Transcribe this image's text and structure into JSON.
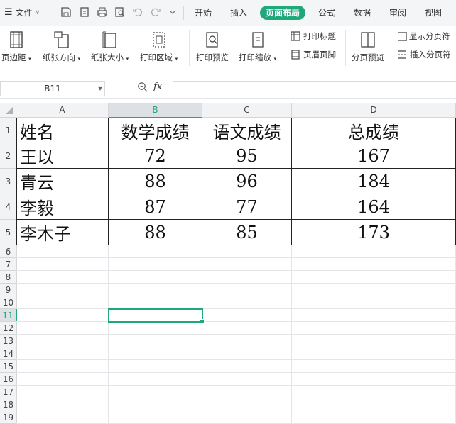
{
  "file_menu": {
    "label": "文件"
  },
  "tabs": [
    {
      "label": "开始",
      "active": false
    },
    {
      "label": "插入",
      "active": false
    },
    {
      "label": "页面布局",
      "active": true
    },
    {
      "label": "公式",
      "active": false
    },
    {
      "label": "数据",
      "active": false
    },
    {
      "label": "审阅",
      "active": false
    },
    {
      "label": "视图",
      "active": false
    }
  ],
  "ribbon": {
    "margins": "页边距",
    "orientation": "纸张方向",
    "size": "纸张大小",
    "print_area": "打印区域",
    "print_preview": "打印预览",
    "print_scale": "打印缩放",
    "print_titles": "打印标题",
    "header_footer": "页眉页脚",
    "page_break_preview": "分页预览",
    "show_page_breaks": "显示分页符",
    "insert_page_break": "插入分页符"
  },
  "formula_bar": {
    "name_box": "B11",
    "fx": "fx",
    "value": ""
  },
  "columns": [
    "A",
    "B",
    "C",
    "D"
  ],
  "selected_column": "B",
  "selected_row": 11,
  "rows": [
    "1",
    "2",
    "3",
    "4",
    "5",
    "6",
    "7",
    "8",
    "9",
    "10",
    "11",
    "12",
    "13",
    "14",
    "15",
    "16",
    "17",
    "18",
    "19"
  ],
  "table": {
    "headers": [
      "姓名",
      "数学成绩",
      "语文成绩",
      "总成绩"
    ],
    "rows": [
      [
        "王以",
        "72",
        "95",
        "167"
      ],
      [
        "青云",
        "88",
        "96",
        "184"
      ],
      [
        "李毅",
        "87",
        "77",
        "164"
      ],
      [
        "李木子",
        "88",
        "85",
        "173"
      ]
    ]
  },
  "colors": {
    "accent": "#1fa87a"
  }
}
